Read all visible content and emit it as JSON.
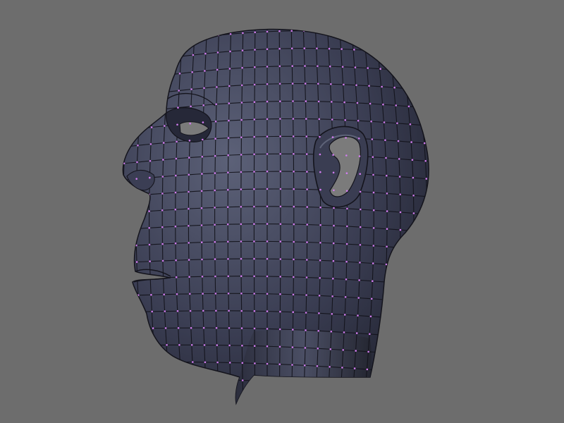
{
  "viewport": {
    "background_color": "#6d6d6d",
    "mesh_surface_color": "#2f3244",
    "mesh_highlight_color": "#5c6178",
    "wire_color": "#14141c",
    "vertex_color": "#d27cf0"
  },
  "scene": {
    "object": "head-mesh",
    "view": "side",
    "shading": "solid-with-wireframe"
  }
}
